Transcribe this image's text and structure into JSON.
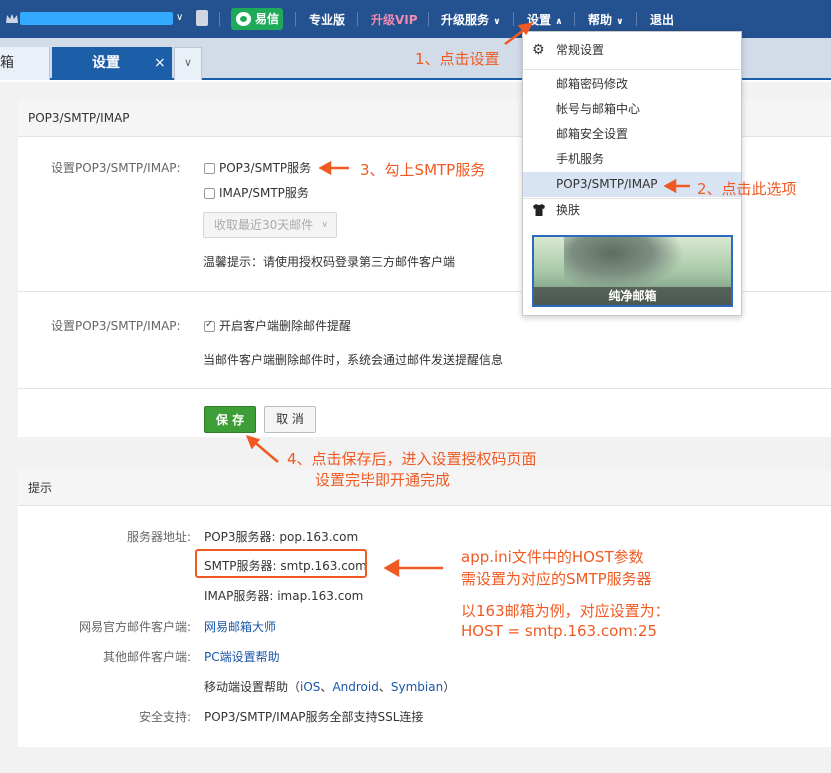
{
  "topbar": {
    "yixin": "易信",
    "items": [
      "专业版",
      "升级VIP",
      "升级服务",
      "设置",
      "帮助",
      "退出"
    ],
    "chevrons": [
      "∨",
      "∨",
      "∧",
      "∨"
    ]
  },
  "tabs": {
    "inbox": "箱",
    "settings": "设置",
    "close": "×",
    "more": "∨"
  },
  "panel1": {
    "title": "POP3/SMTP/IMAP",
    "section1_label": "设置POP3/SMTP/IMAP:",
    "opt_pop3": "POP3/SMTP服务",
    "opt_imap": "IMAP/SMTP服务",
    "select_value": "收取最近30天邮件",
    "select_chev": "∨",
    "tip": "温馨提示：请使用授权码登录第三方邮件客户端",
    "section2_label": "设置POP3/SMTP/IMAP:",
    "opt_notify": "开启客户端删除邮件提醒",
    "notify_desc": "当邮件客户端删除邮件时，系统会通过邮件发送提醒信息",
    "save": "保 存",
    "cancel": "取 消"
  },
  "panel2": {
    "title": "提示",
    "server_label": "服务器地址:",
    "pop3": "POP3服务器: pop.163.com",
    "smtp": "SMTP服务器: smtp.163.com",
    "imap": "IMAP服务器: imap.163.com",
    "official_label": "网易官方邮件客户端:",
    "official_link": "网易邮箱大师",
    "other_label": "其他邮件客户端:",
    "pc_link": "PC端设置帮助",
    "mobile_prefix": "移动端设置帮助（",
    "mobile_ios": "iOS",
    "mobile_android": "Android",
    "mobile_symbian": "Symbian",
    "mobile_sep": "、",
    "mobile_suffix": "）",
    "ssl_label": "安全支持:",
    "ssl_text": "POP3/SMTP/IMAP服务全部支持SSL连接"
  },
  "menu": {
    "items": [
      "常规设置",
      "邮箱密码修改",
      "帐号与邮箱中心",
      "邮箱安全设置",
      "手机服务",
      "POP3/SMTP/IMAP",
      "换肤"
    ],
    "skin_caption": "纯净邮箱"
  },
  "annotations": {
    "step1": "1、点击设置",
    "step2": "2、点击此选项",
    "step3": "3、勾上SMTP服务",
    "step4_line1": "4、点击保存后，进入设置授权码页面",
    "step4_line2": "设置完毕即开通完成",
    "note_line1": "app.ini文件中的HOST参数",
    "note_line2": "需设置为对应的SMTP服务器",
    "note_line3": "以163邮箱为例，对应设置为：",
    "note_line4": "HOST = smtp.163.com:25"
  },
  "colors": {
    "topbar": "#24518f",
    "accent_blue": "#1c5ea8",
    "save_green": "#3d9d36",
    "annotation_orange": "#f05a22",
    "vip_pink": "#f08ab0"
  }
}
